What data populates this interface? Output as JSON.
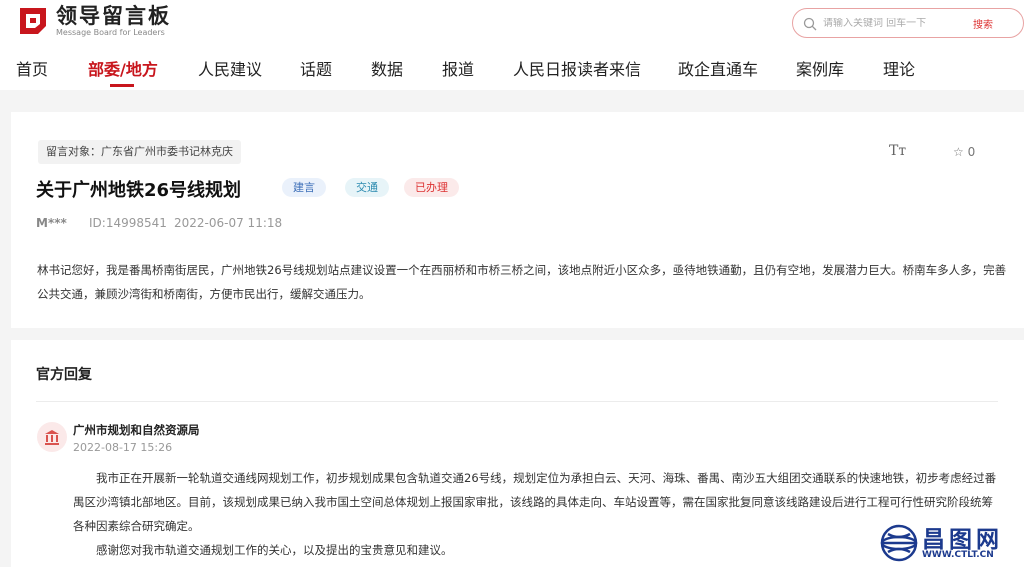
{
  "header": {
    "logo_title": "领导留言板",
    "logo_subtitle": "Message Board for Leaders",
    "search_placeholder": "请输入关键词 回车一下",
    "search_button": "搜索"
  },
  "nav": {
    "items": [
      "首页",
      "部委/地方",
      "人民建议",
      "话题",
      "数据",
      "报道",
      "人民日报读者来信",
      "政企直通车",
      "案例库",
      "理论"
    ],
    "active_index": 1
  },
  "message": {
    "target": "留言对象：广东省广州市委书记林克庆",
    "title": "关于广州地铁26号线规划",
    "tags": [
      "建言",
      "交通",
      "已办理"
    ],
    "font_size_icon": "Tт",
    "favorite_count": "0",
    "author": "M***",
    "id": "ID:14998541",
    "datetime": "2022-06-07 11:18",
    "content": "林书记您好，我是番禺桥南街居民，广州地铁26号线规划站点建议设置一个在西丽桥和市桥三桥之间，该地点附近小区众多，亟待地铁通勤，且仍有空地，发展潜力巨大。桥南车多人多，完善公共交通，兼顾沙湾街和桥南街，方便市民出行，缓解交通压力。"
  },
  "reply": {
    "section_title": "官方回复",
    "department": "广州市规划和自然资源局",
    "datetime": "2022-08-17 15:26",
    "paragraph1": "我市正在开展新一轮轨道交通线网规划工作，初步规划成果包含轨道交通26号线，规划定位为承担白云、天河、海珠、番禺、南沙五大组团交通联系的快速地铁，初步考虑经过番禺区沙湾镇北部地区。目前，该规划成果已纳入我市国土空间总体规划上报国家审批，该线路的具体走向、车站设置等，需在国家批复同意该线路建设后进行工程可行性研究阶段统筹各种因素综合研究确定。",
    "paragraph2": "感谢您对我市轨道交通规划工作的关心，以及提出的宝贵意见和建议。"
  },
  "watermark": {
    "text": "昌图网",
    "url": "WWW.CTLT.CN"
  },
  "colors": {
    "brand_red": "#c8161d",
    "watermark_blue": "#1c3a8e"
  }
}
